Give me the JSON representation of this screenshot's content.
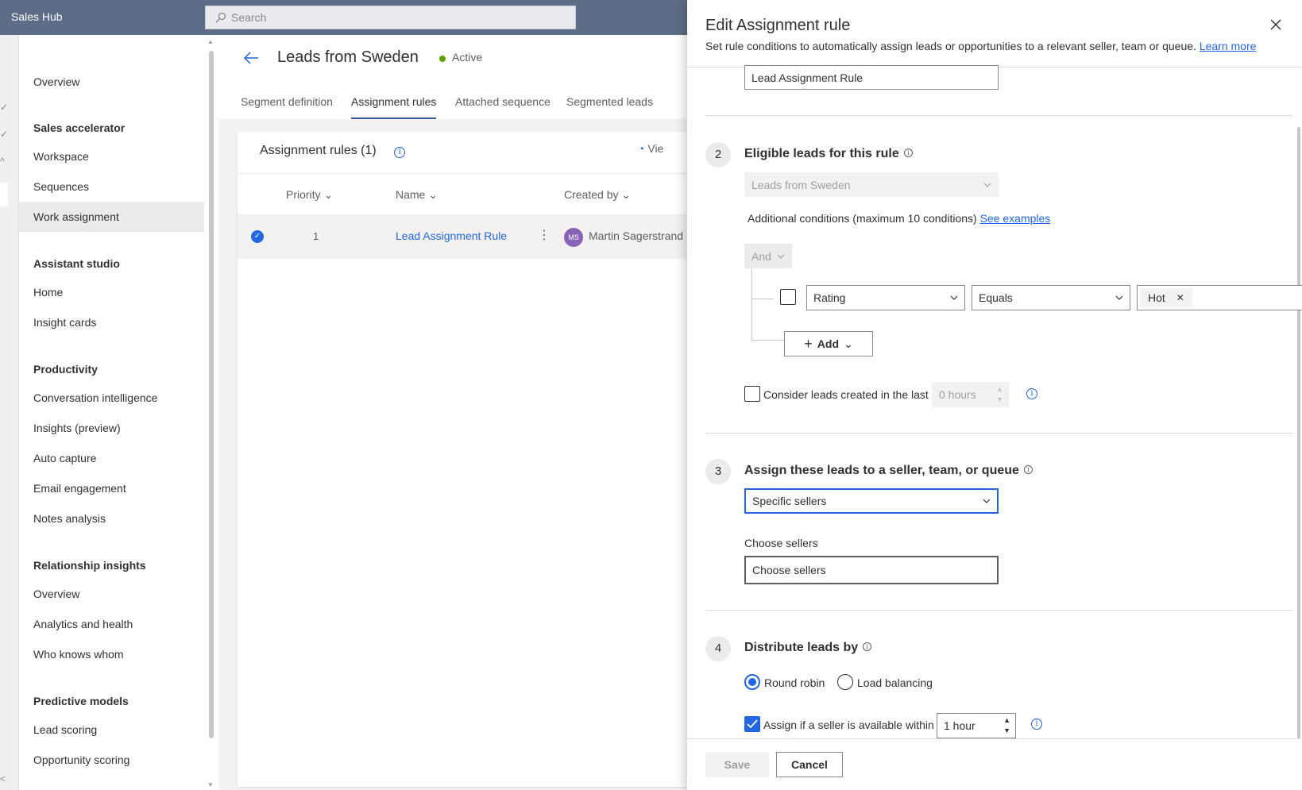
{
  "app": {
    "title": "Sales Hub"
  },
  "search": {
    "placeholder": "Search"
  },
  "sidebar": {
    "items": [
      {
        "label": "Overview"
      },
      {
        "label": "Workspace"
      },
      {
        "label": "Sequences"
      },
      {
        "label": "Work assignment"
      },
      {
        "label": "Home"
      },
      {
        "label": "Insight cards"
      },
      {
        "label": "Conversation intelligence"
      },
      {
        "label": "Insights (preview)"
      },
      {
        "label": "Auto capture"
      },
      {
        "label": "Email engagement"
      },
      {
        "label": "Notes analysis"
      },
      {
        "label": "Overview"
      },
      {
        "label": "Analytics and health"
      },
      {
        "label": "Who knows whom"
      },
      {
        "label": "Lead scoring"
      },
      {
        "label": "Opportunity scoring"
      }
    ],
    "headings": [
      {
        "label": "Sales accelerator"
      },
      {
        "label": "Assistant studio"
      },
      {
        "label": "Productivity"
      },
      {
        "label": "Relationship insights"
      },
      {
        "label": "Predictive models"
      }
    ]
  },
  "page": {
    "title": "Leads from Sweden",
    "status": "Active",
    "tabs": [
      {
        "label": "Segment definition"
      },
      {
        "label": "Assignment rules"
      },
      {
        "label": "Attached sequence"
      },
      {
        "label": "Segmented leads"
      }
    ]
  },
  "rules_card": {
    "title": "Assignment rules (1)",
    "view_label": "Vie",
    "columns": {
      "priority": "Priority",
      "name": "Name",
      "created_by": "Created by"
    },
    "rows": [
      {
        "priority": "1",
        "name": "Lead Assignment Rule",
        "avatar": "MS",
        "created_by": "Martin Sagerstrand"
      }
    ]
  },
  "panel": {
    "title": "Edit Assignment rule",
    "description": "Set rule conditions to automatically assign leads or opportunities to a relevant seller, team or queue.",
    "learn_more": "Learn more",
    "rule_name_value": "Lead Assignment Rule",
    "step2": {
      "number": "2",
      "title": "Eligible leads for this rule",
      "segment_value": "Leads from Sweden",
      "additional_conditions": "Additional conditions (maximum 10 conditions)",
      "see_examples": "See examples",
      "and_label": "And",
      "condition": {
        "field": "Rating",
        "operator": "Equals",
        "value_tag": "Hot"
      },
      "add_label": "Add",
      "consider_label": "Consider leads created in the last",
      "hours_value": "0 hours"
    },
    "step3": {
      "number": "3",
      "title": "Assign these leads to a seller, team, or queue",
      "assign_value": "Specific sellers",
      "choose_label": "Choose sellers",
      "choose_placeholder": "Choose sellers"
    },
    "step4": {
      "number": "4",
      "title": "Distribute leads by",
      "round_robin": "Round robin",
      "load_balancing": "Load balancing",
      "assign_if_label": "Assign if a seller is available within",
      "hour_value": "1 hour"
    },
    "footer": {
      "save": "Save",
      "cancel": "Cancel"
    }
  },
  "colors": {
    "accent": "#2266e3",
    "topbar": "#5d6d87",
    "active_status": "#57a300",
    "avatar": "#8764b8"
  }
}
